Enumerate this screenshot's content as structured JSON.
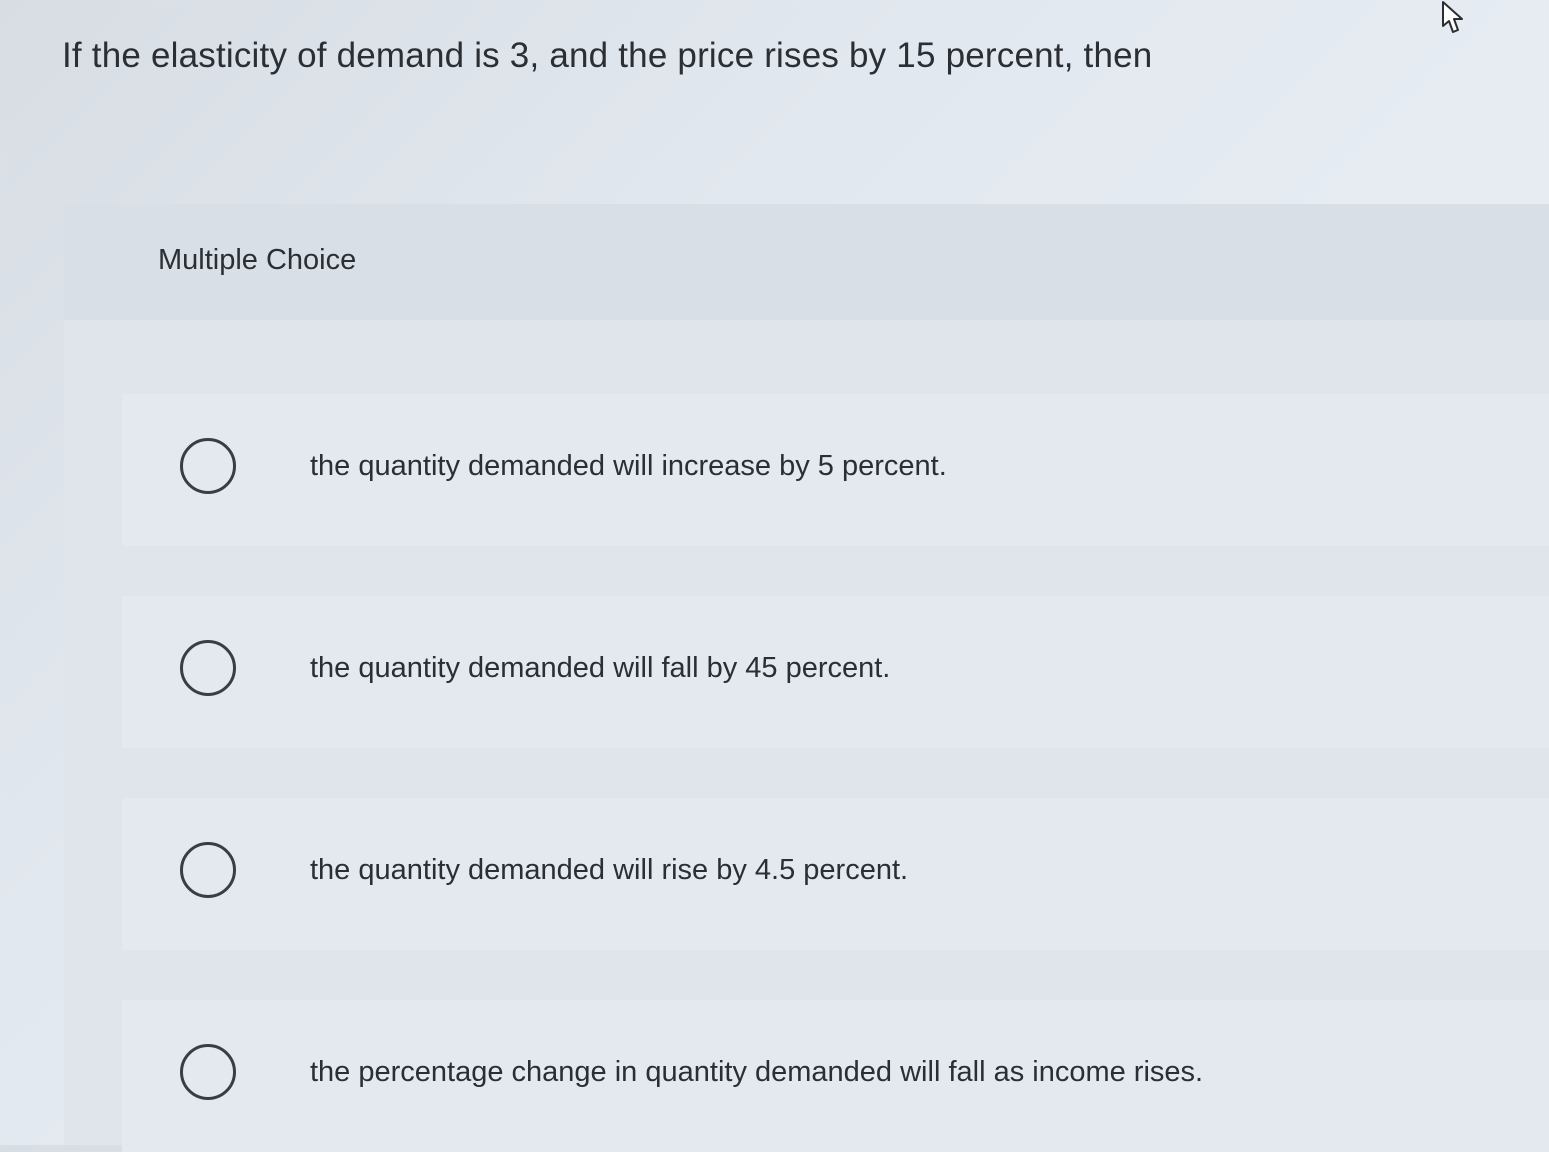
{
  "question": {
    "text": "If the elasticity of demand is 3, and the price rises by 15 percent, then"
  },
  "panel": {
    "title": "Multiple Choice"
  },
  "options": [
    {
      "label": "the quantity demanded will increase by 5 percent."
    },
    {
      "label": "the quantity demanded will fall by 45 percent."
    },
    {
      "label": "the quantity demanded will rise by 4.5 percent."
    },
    {
      "label": "the percentage change in quantity demanded will fall as income rises."
    }
  ],
  "cursor": {
    "icon": "pointer-cursor-icon"
  }
}
